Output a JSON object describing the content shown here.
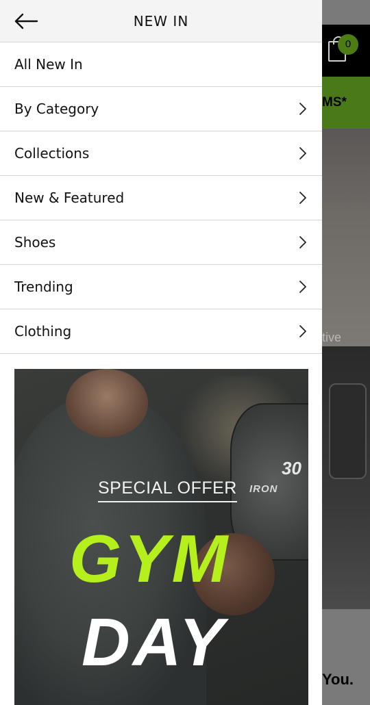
{
  "drawer": {
    "title": "NEW IN",
    "back_icon": "arrow-left-icon",
    "items": [
      {
        "label": "All New In",
        "has_chevron": false
      },
      {
        "label": "By Category",
        "has_chevron": true
      },
      {
        "label": "Collections",
        "has_chevron": true
      },
      {
        "label": "New & Featured",
        "has_chevron": true
      },
      {
        "label": "Shoes",
        "has_chevron": true
      },
      {
        "label": "Trending",
        "has_chevron": true
      },
      {
        "label": "Clothing",
        "has_chevron": true
      }
    ]
  },
  "banner": {
    "offer": "SPECIAL OFFER",
    "line1": "GYM",
    "line2": "DAY",
    "plate_number": "30",
    "plate_brand": "IRON",
    "accent_color": "#b5f01c"
  },
  "background_page": {
    "cart_count": "0",
    "promo_fragment": "MS*",
    "hero_text_fragment": "tive",
    "footer_fragment": "You."
  }
}
